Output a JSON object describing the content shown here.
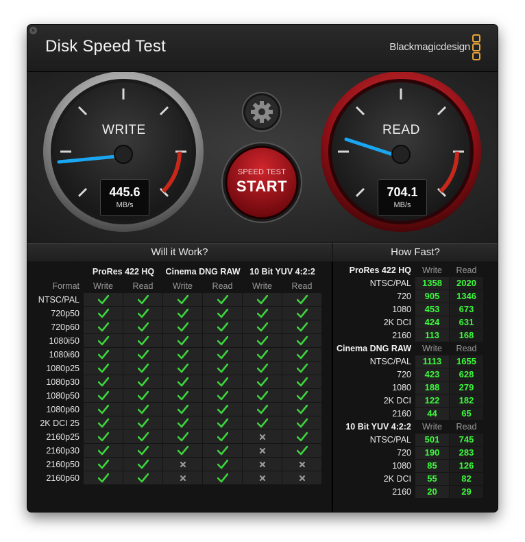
{
  "window": {
    "title": "Disk Speed Test",
    "brand": "Blackmagicdesign"
  },
  "gauges": {
    "write": {
      "label": "WRITE",
      "value": "445.6",
      "unit": "MB/s"
    },
    "read": {
      "label": "READ",
      "value": "704.1",
      "unit": "MB/s"
    }
  },
  "start_button": {
    "small": "SPEED TEST",
    "big": "START"
  },
  "will_it_work": {
    "title": "Will it Work?",
    "groups": [
      "ProRes 422 HQ",
      "Cinema DNG RAW",
      "10 Bit YUV 4:2:2"
    ],
    "format_header": "Format",
    "write_label": "Write",
    "read_label": "Read",
    "rows": [
      {
        "format": "NTSC/PAL",
        "results": [
          1,
          1,
          1,
          1,
          1,
          1
        ]
      },
      {
        "format": "720p50",
        "results": [
          1,
          1,
          1,
          1,
          1,
          1
        ]
      },
      {
        "format": "720p60",
        "results": [
          1,
          1,
          1,
          1,
          1,
          1
        ]
      },
      {
        "format": "1080i50",
        "results": [
          1,
          1,
          1,
          1,
          1,
          1
        ]
      },
      {
        "format": "1080i60",
        "results": [
          1,
          1,
          1,
          1,
          1,
          1
        ]
      },
      {
        "format": "1080p25",
        "results": [
          1,
          1,
          1,
          1,
          1,
          1
        ]
      },
      {
        "format": "1080p30",
        "results": [
          1,
          1,
          1,
          1,
          1,
          1
        ]
      },
      {
        "format": "1080p50",
        "results": [
          1,
          1,
          1,
          1,
          1,
          1
        ]
      },
      {
        "format": "1080p60",
        "results": [
          1,
          1,
          1,
          1,
          1,
          1
        ]
      },
      {
        "format": "2K DCI 25",
        "results": [
          1,
          1,
          1,
          1,
          1,
          1
        ]
      },
      {
        "format": "2160p25",
        "results": [
          1,
          1,
          1,
          1,
          0,
          1
        ]
      },
      {
        "format": "2160p30",
        "results": [
          1,
          1,
          1,
          1,
          0,
          1
        ]
      },
      {
        "format": "2160p50",
        "results": [
          1,
          1,
          0,
          1,
          0,
          0
        ]
      },
      {
        "format": "2160p60",
        "results": [
          1,
          1,
          0,
          1,
          0,
          0
        ]
      }
    ]
  },
  "how_fast": {
    "title": "How Fast?",
    "write_label": "Write",
    "read_label": "Read",
    "blocks": [
      {
        "name": "ProRes 422 HQ",
        "rows": [
          {
            "format": "NTSC/PAL",
            "write": "1358",
            "read": "2020"
          },
          {
            "format": "720",
            "write": "905",
            "read": "1346"
          },
          {
            "format": "1080",
            "write": "453",
            "read": "673"
          },
          {
            "format": "2K DCI",
            "write": "424",
            "read": "631"
          },
          {
            "format": "2160",
            "write": "113",
            "read": "168"
          }
        ]
      },
      {
        "name": "Cinema DNG RAW",
        "rows": [
          {
            "format": "NTSC/PAL",
            "write": "1113",
            "read": "1655"
          },
          {
            "format": "720",
            "write": "423",
            "read": "628"
          },
          {
            "format": "1080",
            "write": "188",
            "read": "279"
          },
          {
            "format": "2K DCI",
            "write": "122",
            "read": "182"
          },
          {
            "format": "2160",
            "write": "44",
            "read": "65"
          }
        ]
      },
      {
        "name": "10 Bit YUV 4:2:2",
        "rows": [
          {
            "format": "NTSC/PAL",
            "write": "501",
            "read": "745"
          },
          {
            "format": "720",
            "write": "190",
            "read": "283"
          },
          {
            "format": "1080",
            "write": "85",
            "read": "126"
          },
          {
            "format": "2K DCI",
            "write": "55",
            "read": "82"
          },
          {
            "format": "2160",
            "write": "20",
            "read": "29"
          }
        ]
      }
    ]
  },
  "colors": {
    "accent_needle": "#1aa6f0",
    "ok": "#3dd43d",
    "fail": "#9a9a9a",
    "red_ring": "#a8121b",
    "brand": "#e8a43a"
  },
  "icons": {
    "gear": "gear-icon",
    "close": "close-icon",
    "check": "check-icon",
    "cross": "cross-icon"
  }
}
